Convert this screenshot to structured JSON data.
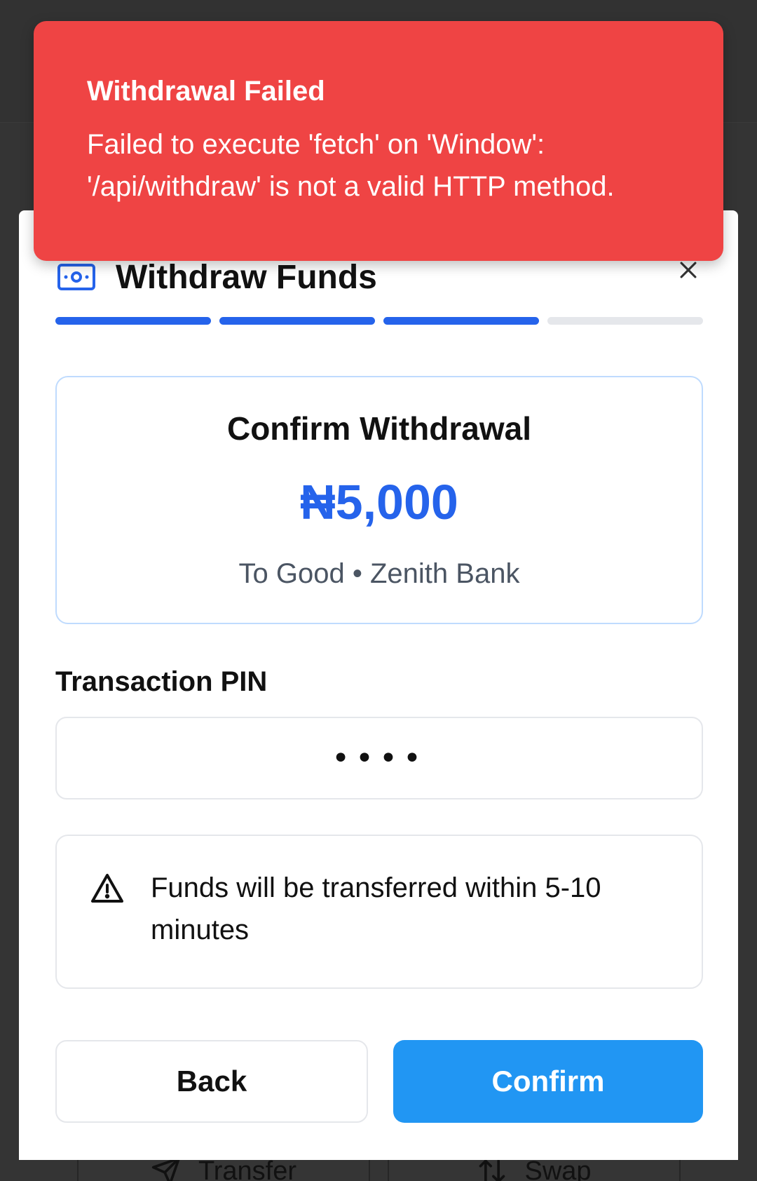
{
  "background": {
    "actions": [
      {
        "label": "Transfer",
        "icon": "send-icon"
      },
      {
        "label": "Swap",
        "icon": "swap-icon"
      }
    ]
  },
  "modal": {
    "title": "Withdraw Funds",
    "title_icon": "money-icon",
    "close_icon": "close-icon",
    "progress": {
      "total_steps": 4,
      "completed_steps": 3
    },
    "summary": {
      "title": "Confirm Withdrawal",
      "amount": "₦5,000",
      "recipient": "To Good • Zenith Bank"
    },
    "pin": {
      "label": "Transaction PIN",
      "value": "••••"
    },
    "notice": {
      "icon": "warning-icon",
      "text": "Funds will be transferred within 5-10 minutes"
    },
    "buttons": {
      "back": "Back",
      "confirm": "Confirm"
    }
  },
  "toast": {
    "title": "Withdrawal Failed",
    "message": "Failed to execute 'fetch' on 'Window': '/api/withdraw' is not a valid HTTP method."
  },
  "colors": {
    "accent": "#2563eb",
    "confirm_button": "#2196f3",
    "error": "#ef4444",
    "progress_inactive": "#e5e7eb"
  }
}
